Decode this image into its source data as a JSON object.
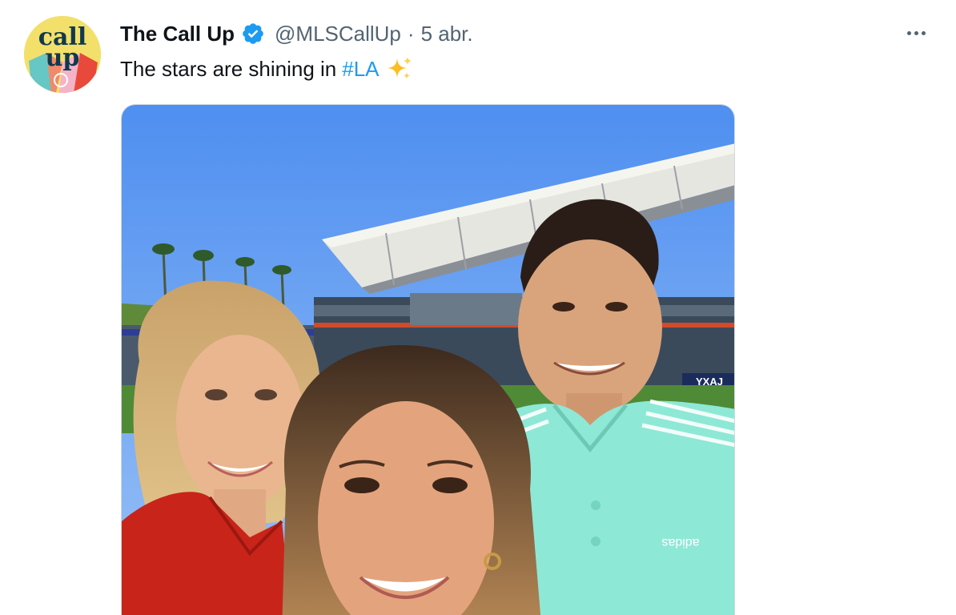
{
  "tweet": {
    "avatar": {
      "line1": "call",
      "line2": "up",
      "icon": "the-call-up-logo"
    },
    "display_name": "The Call Up",
    "verified_icon": "verified-badge-icon",
    "handle": "@MLSCallUp",
    "separator": "·",
    "time": "5 abr.",
    "text": "The stars are shining in",
    "hashtag": "#LA",
    "emoji": "sparkles-emoji",
    "more_icon": "more-options-icon"
  },
  "media": {
    "kind": "photo",
    "stadium_sign_text": "YXAJ",
    "shirt_logo_text": "adidas",
    "colors": {
      "sky": "#5f9cf3",
      "turquoise_jersey": "#8ee8d6",
      "red_jacket": "#c9241a"
    }
  },
  "colors": {
    "link": "#1d9bf0",
    "secondary_text": "#536471",
    "primary_text": "#0f1419",
    "border": "#cfd9de"
  }
}
